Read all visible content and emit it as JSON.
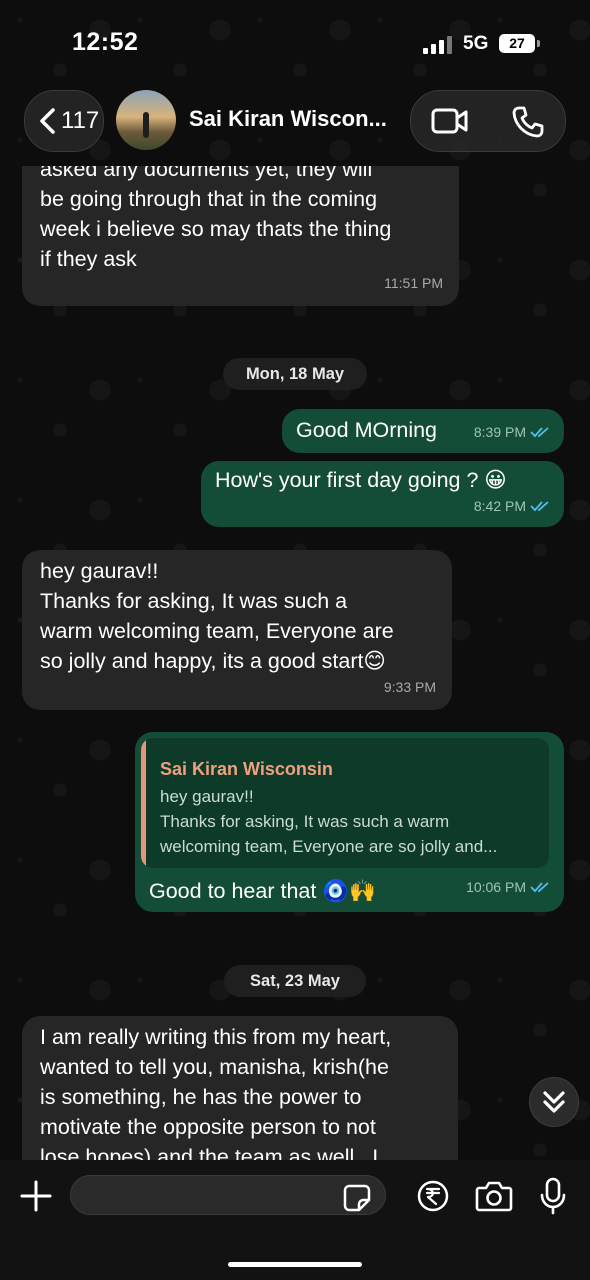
{
  "status_bar": {
    "time": "12:52",
    "network": "5G",
    "battery": "27"
  },
  "header": {
    "back_count": "117",
    "contact_name": "Sai Kiran Wiscon...",
    "icons": [
      "chevron-left-icon",
      "video-call-icon",
      "phone-icon"
    ]
  },
  "messages": [
    {
      "direction": "incoming",
      "text": "I hope so too gaurav, but they haven't\nasked any documents yet, they will\nbe going through that in the coming\nweek i believe so may thats the thing\nif they ask",
      "time": "11:51 PM"
    },
    {
      "type": "date",
      "label": "Mon, 18 May"
    },
    {
      "direction": "outgoing",
      "text": "Good MOrning",
      "time": "8:39 PM",
      "status": "read"
    },
    {
      "direction": "outgoing",
      "text": "How's your first day going ? 😀",
      "time": "8:42 PM",
      "status": "read"
    },
    {
      "direction": "incoming",
      "text": "hey gaurav!!\nThanks for asking, It was such a\nwarm welcoming team, Everyone are\nso jolly and happy, its a good start😊",
      "time": "9:33 PM"
    },
    {
      "direction": "outgoing",
      "reply_to": {
        "name": "Sai Kiran Wisconsin",
        "text": "hey gaurav!!\nThanks for asking, It was such a warm\nwelcoming team, Everyone are so jolly and..."
      },
      "text": "Good to hear that 🧿🙌",
      "time": "10:06 PM",
      "status": "read"
    },
    {
      "type": "date",
      "label": "Sat, 23 May"
    },
    {
      "direction": "incoming",
      "text": "I am really writing this from my heart,\nwanted to tell you, manisha, krish(he\nis something, he has the power to\nmotivate the opposite person to not\nlose hopes) and the team as well.. I",
      "time": ""
    }
  ],
  "input": {
    "value": "",
    "placeholder": ""
  },
  "colors": {
    "incoming": "#262626",
    "outgoing": "#144d37",
    "read_ticks": "#53bdeb",
    "quote_name": "#f0a07f"
  }
}
